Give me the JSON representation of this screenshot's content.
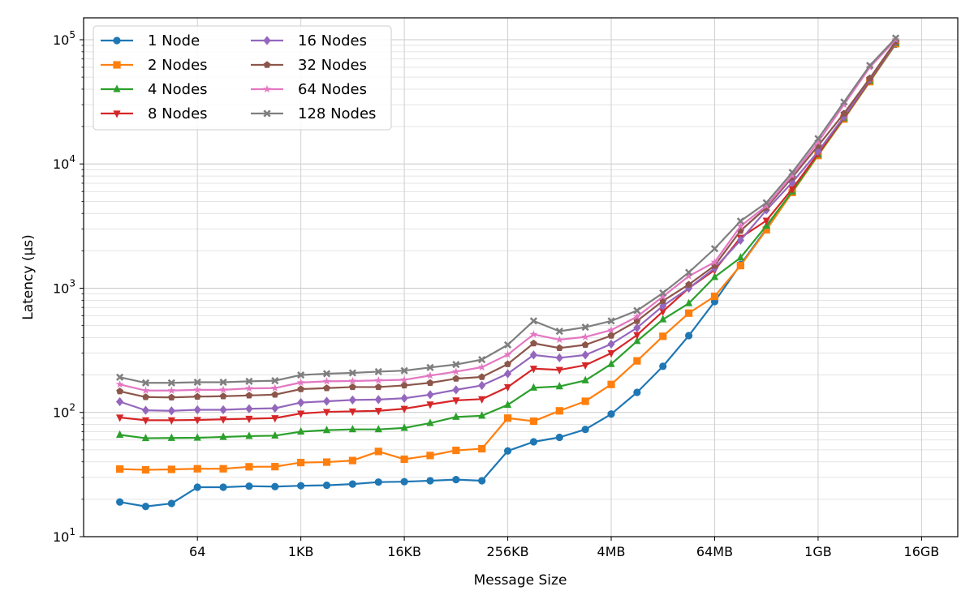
{
  "chart_data": {
    "type": "line",
    "title": "",
    "xlabel": "Message Size",
    "ylabel": "Latency (µs)",
    "y_scale": "log",
    "x_scale": "log2",
    "ylim": [
      10,
      150000
    ],
    "x_units": "bytes",
    "x": [
      8,
      16,
      32,
      64,
      128,
      256,
      512,
      1024,
      2048,
      4096,
      8192,
      16384,
      32768,
      65536,
      131072,
      262144,
      524288,
      1048576,
      2097152,
      4194304,
      8388608,
      16777216,
      33554432,
      67108864,
      134217728,
      268435456,
      536870912,
      1073741824,
      2147483648,
      4294967296,
      8589934592,
      17179869184
    ],
    "x_tick_values": [
      64,
      1024,
      16384,
      262144,
      4194304,
      67108864,
      1073741824,
      17179869184
    ],
    "x_tick_labels": [
      "64",
      "1KB",
      "16KB",
      "256KB",
      "4MB",
      "64MB",
      "1GB",
      "16GB"
    ],
    "y_ticks": [
      10,
      100,
      1000,
      10000,
      100000
    ],
    "grid": true,
    "legend": {
      "position": "top-left",
      "columns": 2
    },
    "series": [
      {
        "name": "1 Node",
        "color": "#1f77b4",
        "marker": "circle",
        "values": [
          19,
          17.5,
          18.5,
          25,
          25,
          25.5,
          25.3,
          25.7,
          25.9,
          26.5,
          27.5,
          27.7,
          28.2,
          28.8,
          28.2,
          49,
          58,
          63,
          73,
          97,
          145,
          235,
          415,
          780,
          1550,
          3000,
          6000,
          11800,
          23000,
          46000,
          92000
        ]
      },
      {
        "name": "2 Nodes",
        "color": "#ff7f0e",
        "marker": "square",
        "values": [
          35,
          34.5,
          34.8,
          35.2,
          35.2,
          36.5,
          36.6,
          39.5,
          39.8,
          41,
          48.5,
          42,
          45,
          49.5,
          51,
          90,
          85,
          103,
          123,
          168,
          260,
          410,
          630,
          860,
          1520,
          2950,
          5900,
          11700,
          23000,
          46000,
          93000
        ]
      },
      {
        "name": "4 Nodes",
        "color": "#2ca02c",
        "marker": "triangle-up",
        "values": [
          66,
          62,
          62.3,
          62.5,
          63.5,
          64.5,
          65,
          70,
          72,
          73,
          73,
          75,
          82,
          92,
          94,
          115,
          158,
          162,
          181,
          245,
          375,
          560,
          755,
          1230,
          1760,
          3180,
          6000,
          11900,
          23300,
          46500,
          94000
        ]
      },
      {
        "name": "8 Nodes",
        "color": "#d62728",
        "marker": "triangle-down",
        "values": [
          91,
          86.5,
          86.5,
          87,
          88,
          89,
          90,
          98,
          101,
          102,
          103,
          107,
          116,
          125,
          128,
          160,
          225,
          220,
          240,
          300,
          420,
          650,
          1000,
          1400,
          2550,
          3500,
          6300,
          12100,
          23600,
          47000,
          95000
        ]
      },
      {
        "name": "16 Nodes",
        "color": "#9467bd",
        "marker": "diamond",
        "values": [
          122,
          104,
          103,
          105,
          105,
          107,
          108,
          120,
          123,
          126,
          127,
          130,
          139,
          152,
          165,
          205,
          290,
          275,
          290,
          355,
          480,
          720,
          1000,
          1450,
          2430,
          4250,
          7100,
          12600,
          24000,
          48000,
          96000
        ]
      },
      {
        "name": "32 Nodes",
        "color": "#8c564b",
        "marker": "pentagon",
        "values": [
          148,
          133,
          132,
          134,
          135,
          137,
          139,
          154,
          157,
          160,
          160,
          165,
          173,
          187,
          193,
          245,
          360,
          330,
          350,
          415,
          545,
          790,
          1070,
          1520,
          2900,
          4450,
          7800,
          14000,
          25500,
          49000,
          97000
        ]
      },
      {
        "name": "64 Nodes",
        "color": "#e377c2",
        "marker": "star",
        "values": [
          168,
          150,
          150,
          152,
          152,
          156,
          157,
          174,
          178,
          179,
          181,
          183,
          198,
          213,
          231,
          292,
          425,
          385,
          405,
          460,
          590,
          855,
          1250,
          1620,
          3150,
          4600,
          8100,
          15000,
          30000,
          60000,
          100000
        ]
      },
      {
        "name": "128 Nodes",
        "color": "#7f7f7f",
        "marker": "x-filled",
        "values": [
          192,
          173,
          173,
          175,
          175,
          178,
          180,
          200,
          205,
          208,
          213,
          217,
          230,
          243,
          266,
          350,
          545,
          450,
          485,
          545,
          660,
          915,
          1340,
          2080,
          3470,
          4870,
          8550,
          16000,
          31500,
          62000,
          103000
        ]
      }
    ]
  }
}
